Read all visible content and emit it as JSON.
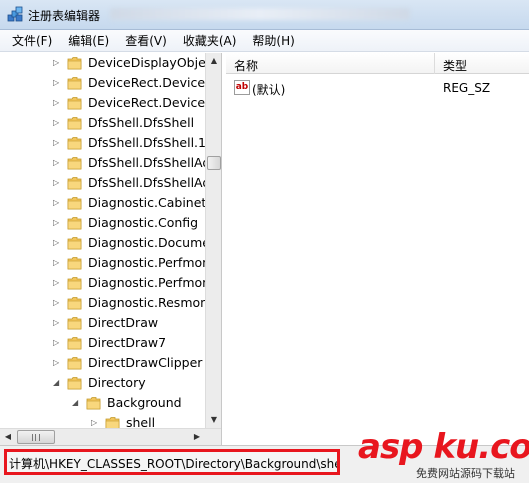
{
  "window": {
    "title": "注册表编辑器"
  },
  "menu": [
    {
      "label": "文件(F)"
    },
    {
      "label": "编辑(E)"
    },
    {
      "label": "查看(V)"
    },
    {
      "label": "收藏夹(A)"
    },
    {
      "label": "帮助(H)"
    }
  ],
  "tree": {
    "items": [
      {
        "label": "DeviceDisplayObject",
        "level": 0
      },
      {
        "label": "DeviceRect.DeviceRe",
        "level": 0
      },
      {
        "label": "DeviceRect.DeviceRe",
        "level": 0
      },
      {
        "label": "DfsShell.DfsShell",
        "level": 0
      },
      {
        "label": "DfsShell.DfsShell.1",
        "level": 0
      },
      {
        "label": "DfsShell.DfsShellAdr",
        "level": 0
      },
      {
        "label": "DfsShell.DfsShellAdr",
        "level": 0
      },
      {
        "label": "Diagnostic.Cabinet",
        "level": 0
      },
      {
        "label": "Diagnostic.Config",
        "level": 0
      },
      {
        "label": "Diagnostic.Documer",
        "level": 0
      },
      {
        "label": "Diagnostic.Perfmon.",
        "level": 0
      },
      {
        "label": "Diagnostic.Perfmon.",
        "level": 0
      },
      {
        "label": "Diagnostic.Resmon.(",
        "level": 0
      },
      {
        "label": "DirectDraw",
        "level": 0
      },
      {
        "label": "DirectDraw7",
        "level": 0
      },
      {
        "label": "DirectDrawClipper",
        "level": 0
      },
      {
        "label": "Directory",
        "level": 0,
        "expanded": true
      },
      {
        "label": "Background",
        "level": 1,
        "open": true
      },
      {
        "label": "shell",
        "level": 2
      }
    ]
  },
  "list": {
    "columns": {
      "name": "名称",
      "type": "类型"
    },
    "rows": [
      {
        "name": "(默认)",
        "type": "REG_SZ",
        "icon": "ab-string-icon"
      }
    ]
  },
  "status": {
    "path": "计算机\\HKEY_CLASSES_ROOT\\Directory\\Background\\shell"
  },
  "watermark": {
    "logo": "asp ku.com",
    "subtitle": "免费网站源码下载站"
  },
  "colors": {
    "highlight": "#e8161e",
    "folder": "#f2c55c"
  }
}
